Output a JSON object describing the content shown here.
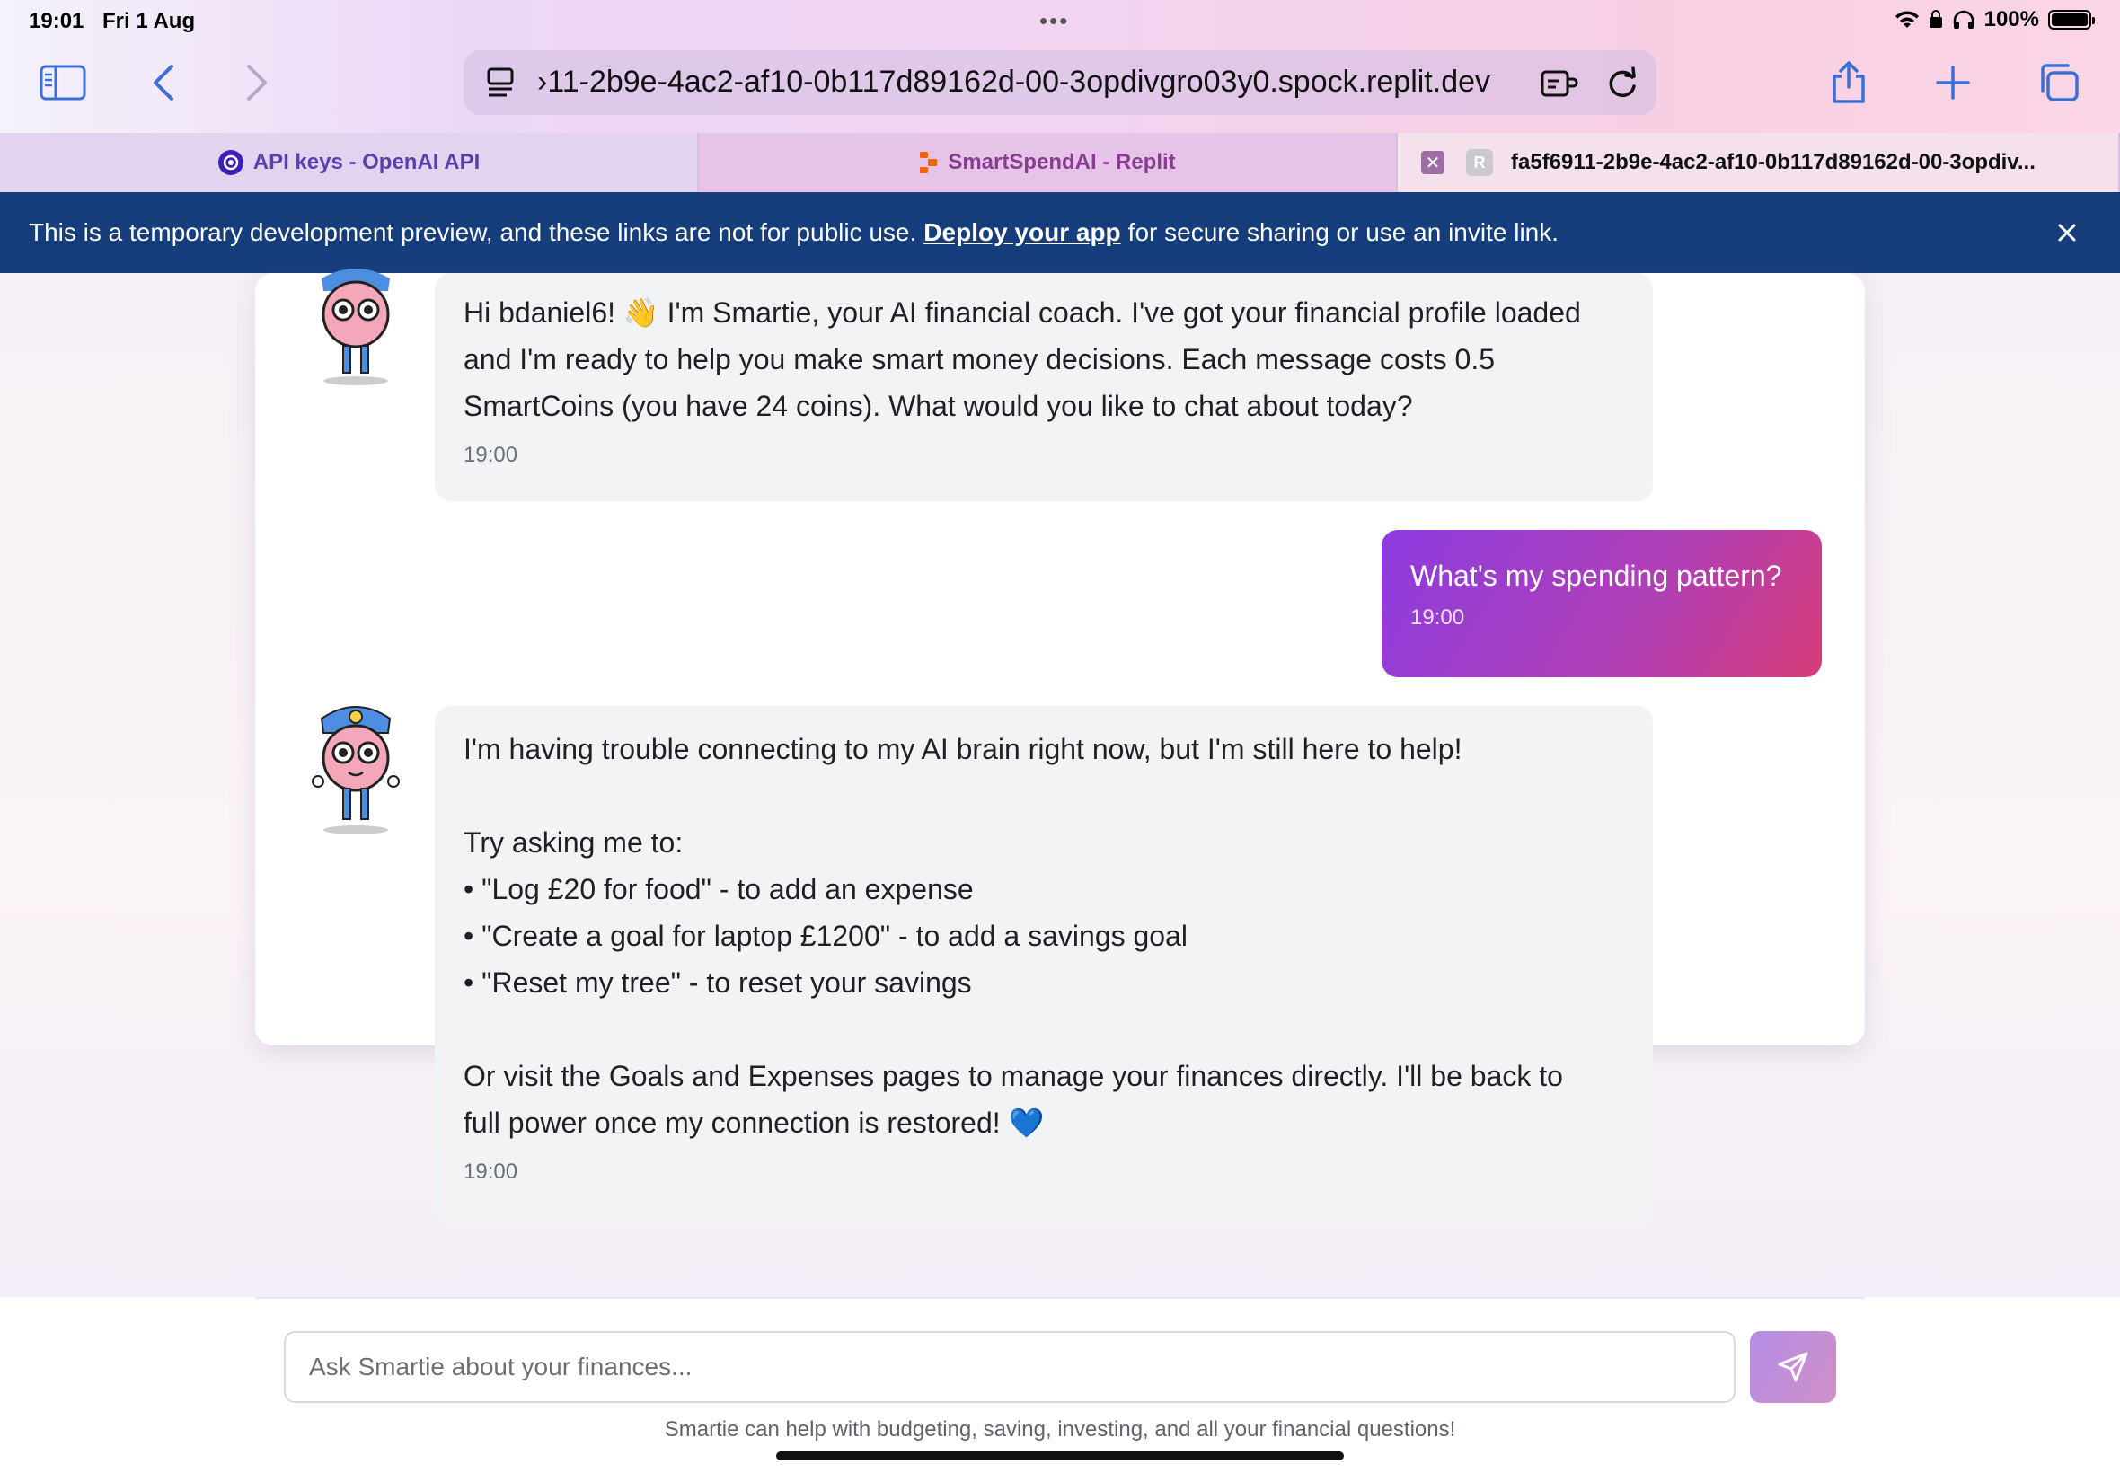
{
  "status_bar": {
    "time": "19:01",
    "date": "Fri 1 Aug",
    "battery": "100%"
  },
  "browser": {
    "url": "›11-2b9e-4ac2-af10-0b117d89162d-00-3opdivgro03y0.spock.replit.dev",
    "tabs": [
      {
        "label": "API keys - OpenAI API"
      },
      {
        "label": "SmartSpendAI - Replit"
      },
      {
        "label": "fa5f6911-2b9e-4ac2-af10-0b117d89162d-00-3opdiv..."
      }
    ]
  },
  "banner": {
    "text_before": "This is a temporary development preview, and these links are not for public use.",
    "link": "Deploy your app",
    "text_after": "for secure sharing or use an invite link."
  },
  "chat": {
    "messages": [
      {
        "role": "assistant",
        "lines": [
          "Hi bdaniel6! 👋 I'm Smartie, your AI financial coach. I've got your financial profile loaded",
          "and I'm ready to help you make smart money decisions. Each message costs 0.5",
          "SmartCoins (you have 24 coins). What would you like to chat about today?"
        ],
        "time": "19:00"
      },
      {
        "role": "user",
        "text": "What's my spending pattern?",
        "time": "19:00"
      },
      {
        "role": "assistant",
        "lines": [
          "I'm having trouble connecting to my AI brain right now, but I'm still here to help!",
          "",
          "Try asking me to:",
          "• \"Log £20 for food\" - to add an expense",
          "• \"Create a goal for laptop £1200\" - to add a savings goal",
          "• \"Reset my tree\" - to reset your savings",
          "",
          "Or visit the Goals and Expenses pages to manage your finances directly. I'll be back to",
          "full power once my connection is restored! 💙"
        ],
        "time": "19:00"
      }
    ]
  },
  "input": {
    "placeholder": "Ask Smartie about your finances...",
    "value": ""
  },
  "footer_note": "Smartie can help with budgeting, saving, investing, and all your financial questions!",
  "colors": {
    "banner": "#163e7c",
    "user_bubble_start": "#8c3ce0",
    "user_bubble_end": "#d63d78",
    "assistant_bubble": "#f2f3f5",
    "send_button": "#c18fd8"
  }
}
